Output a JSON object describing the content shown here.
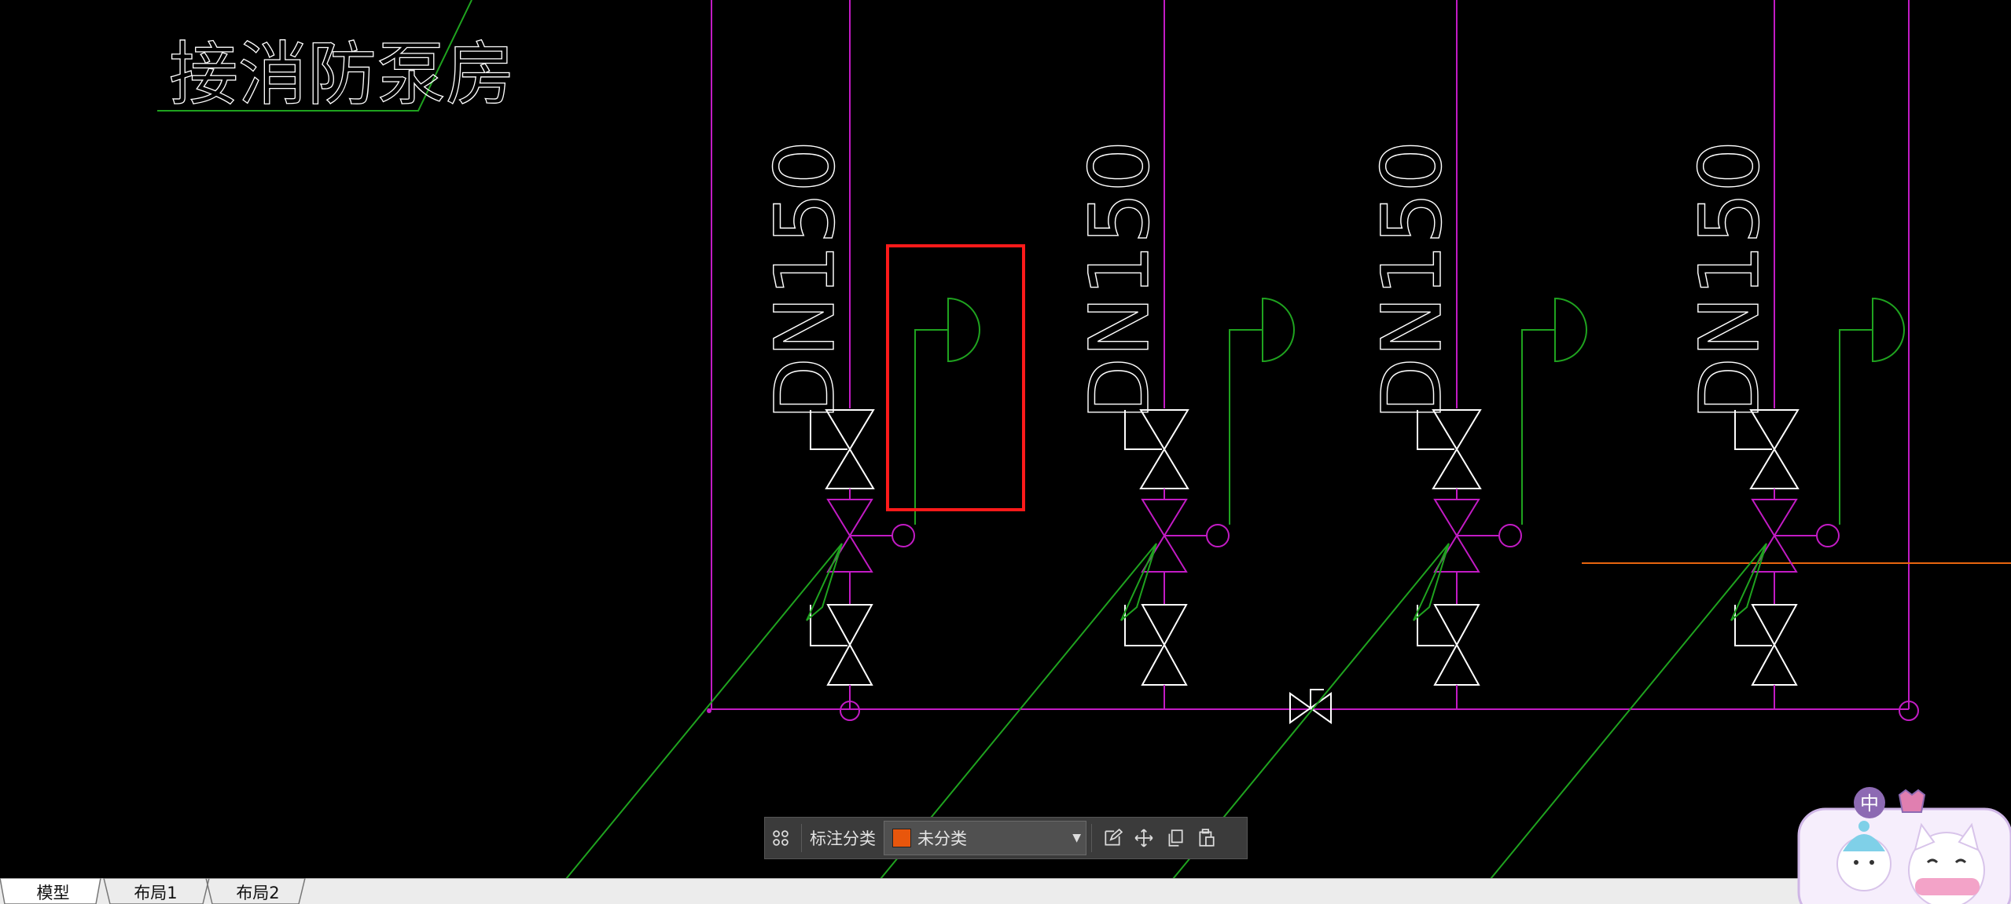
{
  "drawing": {
    "title_text": "接消防泵房",
    "pipe_labels": [
      "DN150",
      "DN150",
      "DN150",
      "DN150"
    ]
  },
  "annotation_toolbar": {
    "grid_icon": "apps-grid-icon",
    "category_label": "标注分类",
    "category_value": "未分类",
    "category_color": "#e8560c",
    "edit_icon": "edit-icon",
    "move_icon": "move-icon",
    "copy_icon": "copy-icon",
    "paste_icon": "paste-icon"
  },
  "layout_tabs": [
    "模型",
    "布局1",
    "布局2"
  ],
  "active_tab": "模型",
  "colors": {
    "background": "#000000",
    "pipe_magenta": "#c21bc4",
    "green_line": "#1fa31f",
    "highlight_red": "#ff1a1a",
    "orange_line": "#e8650f",
    "white_line": "#ffffff"
  },
  "mascot": {
    "badge_text": "中"
  }
}
